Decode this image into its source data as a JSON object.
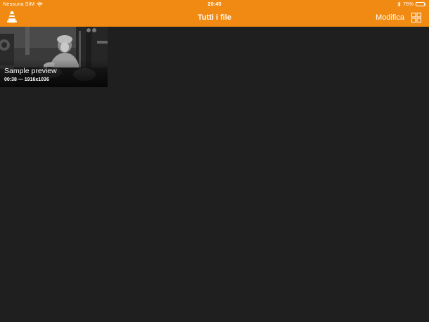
{
  "status_bar": {
    "carrier": "Nessuna SIM",
    "time": "20:45",
    "battery_percent": "76%",
    "battery_level": 0.76
  },
  "nav": {
    "title": "Tutti i file",
    "edit_label": "Modifica",
    "app_icon": "vlc-cone-icon",
    "layout_toggle_icon": "grid-view-icon"
  },
  "media": [
    {
      "title": "Sample preview",
      "duration": "00:38",
      "resolution": "1916x1036",
      "meta": "00:38 — 1916x1036"
    }
  ],
  "colors": {
    "accent": "#f08a13",
    "background": "#1f1f1f"
  }
}
